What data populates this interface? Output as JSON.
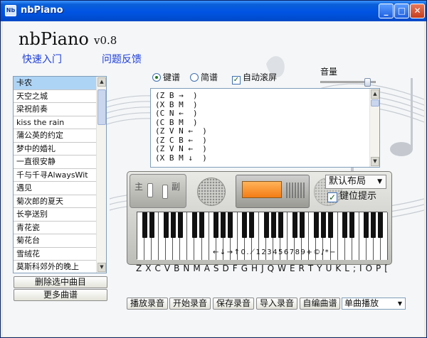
{
  "window": {
    "title": "nbPiano",
    "icon_text": "Nb"
  },
  "header": {
    "app_name": "nbPiano",
    "version": "v0.8",
    "links": {
      "quick_start": "快速入门",
      "feedback": "问题反馈"
    }
  },
  "songs": {
    "items": [
      "卡农",
      "天空之城",
      "梁祝前奏",
      "kiss the rain",
      "蒲公英的约定",
      "梦中的婚礼",
      "一直很安静",
      "千与千寻AlwaysWit",
      "遇见",
      "菊次郎的夏天",
      "长亭送别",
      "青花瓷",
      "菊花台",
      "雪绒花",
      "莫斯科郊外的晚上"
    ],
    "selected_index": 0,
    "delete_button": "删除选中曲目",
    "more_button": "更多曲谱"
  },
  "options": {
    "key_score": "键谱",
    "simple_score": "简谱",
    "auto_scroll": "自动滚屏",
    "volume_label": "音量",
    "volume_level": 0.85
  },
  "score_lines": [
    "(Z B →  )",
    "(X B M  )",
    "(C N ←  )",
    "(C B M  )",
    "(Z V N ←  )",
    "(Z C B ←  )",
    "(Z V N ←  )",
    "(X B M ↓  )"
  ],
  "piano": {
    "left_label_main": "主",
    "left_label_sub": "副",
    "layout_select": "默认布局",
    "key_hint": "键位提示",
    "key_marks": "←↓→↑0.⟋123456789+©/*−"
  },
  "keymap_row": "Z X C V B N M A S D F G H J Q W E R T Y U K L ; I O P [",
  "bottom_buttons": {
    "play": "播放录音",
    "start": "开始录音",
    "save": "保存录音",
    "import": "导入录音",
    "custom": "自编曲谱"
  },
  "mode_select": "单曲播放",
  "colors": {
    "title_bar": "#0054e3",
    "link": "#1f3fd8",
    "selected_row": "#aed4f5"
  }
}
